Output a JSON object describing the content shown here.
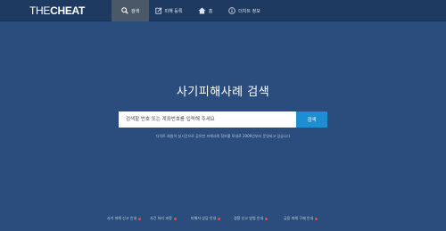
{
  "brand": {
    "logo_part1": "THE",
    "logo_part2": "CHEAT"
  },
  "nav": {
    "search": "검색",
    "report": "피해 등록",
    "home": "홈",
    "info": "더치트 정보"
  },
  "main": {
    "title": "사기피해사례 검색",
    "search_placeholder": "검색할 번호 또는 계좌번호를 입력해 주세요",
    "search_button": "검색",
    "notice": "더치트 회원이 실시간으로 공유한 피해사례 정보를 토대로 2006년부터 운영되고 있습니다"
  },
  "footer": [
    "사기 피해 신고 안내",
    "사건 처리 과정",
    "피해자 상담 안내",
    "경찰 신고 방법 안내",
    "금융 피해 구제 안내"
  ],
  "colors": {
    "background": "#2b4d7e",
    "topbar": "#1f3a61",
    "active_tab": "#4a5868",
    "button": "#1c8fd3",
    "footer_dot": "#e24a4a"
  }
}
